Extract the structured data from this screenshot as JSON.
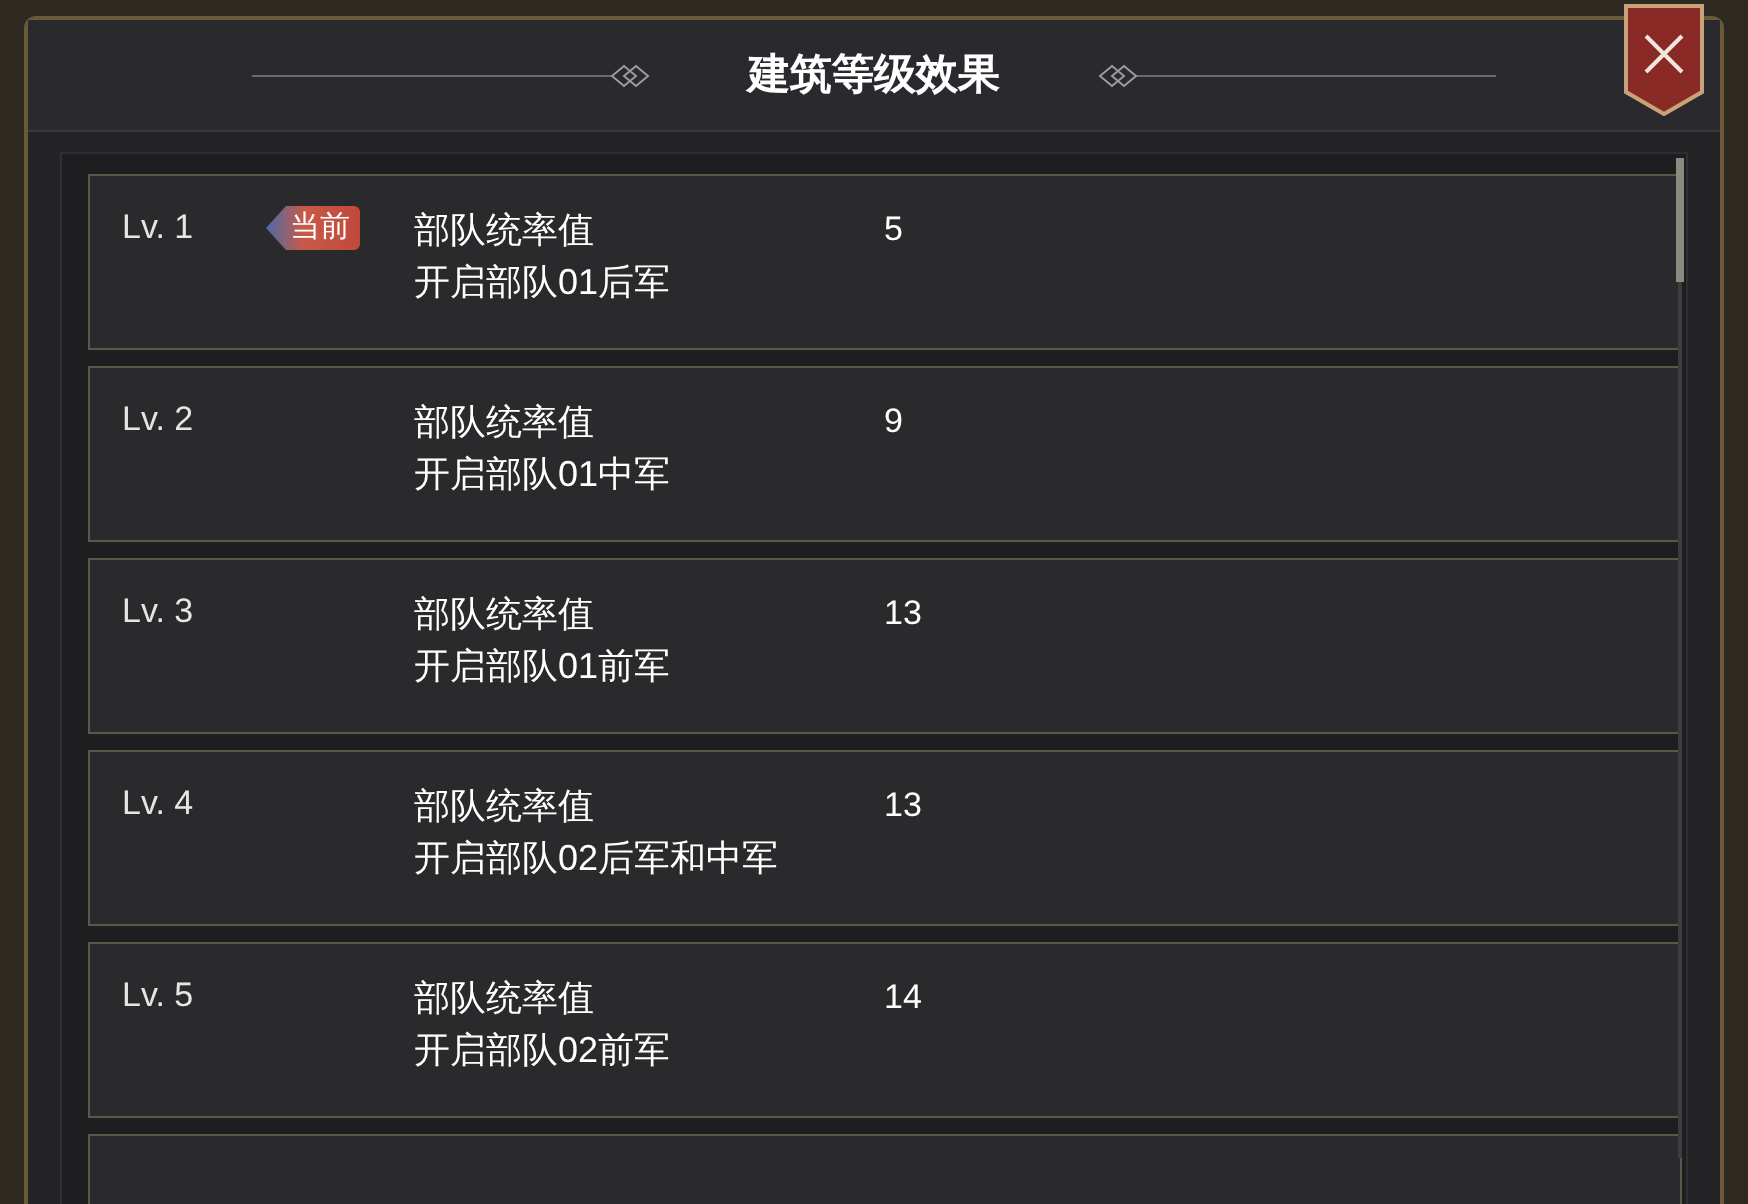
{
  "dialog": {
    "title": "建筑等级效果"
  },
  "levels": [
    {
      "level": "Lv. 1",
      "badge": "当前",
      "effects": [
        {
          "name": "部队统率值",
          "value": "5"
        },
        {
          "name": "开启部队01后军"
        }
      ]
    },
    {
      "level": "Lv. 2",
      "effects": [
        {
          "name": "部队统率值",
          "value": "9"
        },
        {
          "name": "开启部队01中军"
        }
      ]
    },
    {
      "level": "Lv. 3",
      "effects": [
        {
          "name": "部队统率值",
          "value": "13"
        },
        {
          "name": "开启部队01前军"
        }
      ]
    },
    {
      "level": "Lv. 4",
      "effects": [
        {
          "name": "部队统率值",
          "value": "13"
        },
        {
          "name": "开启部队02后军和中军"
        }
      ]
    },
    {
      "level": "Lv. 5",
      "effects": [
        {
          "name": "部队统率值",
          "value": "14"
        },
        {
          "name": "开启部队02前军"
        }
      ]
    }
  ]
}
